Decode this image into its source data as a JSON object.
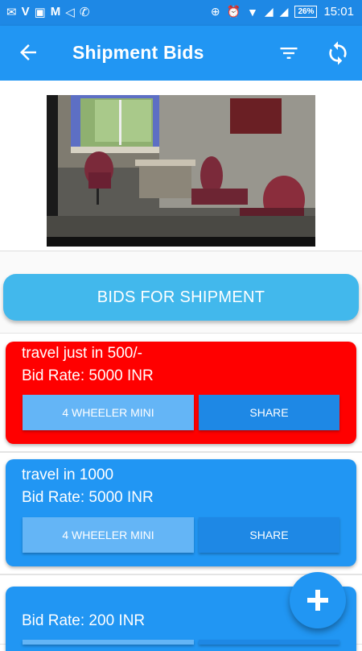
{
  "status_bar": {
    "left_icons": [
      "✉",
      "V",
      "▣",
      "M",
      "◁",
      "✆"
    ],
    "battery": "26%",
    "time": "15:01"
  },
  "app_bar": {
    "title": "Shipment Bids",
    "back_icon": "arrow-left-icon",
    "filter_icon": "filter-icon",
    "refresh_icon": "sync-icon"
  },
  "main": {
    "bids_button_label": "BIDS FOR SHIPMENT",
    "bids": [
      {
        "title": "travel just in 500/-",
        "rate": "Bid Rate: 5000 INR",
        "vehicle": "4 WHEELER MINI",
        "share": "SHARE",
        "color": "#ff0000"
      },
      {
        "title": "travel in 1000",
        "rate": "Bid Rate: 5000 INR",
        "vehicle": "4 WHEELER MINI",
        "share": "SHARE",
        "color": "#2196f3"
      },
      {
        "title": "",
        "rate": "Bid Rate: 200 INR",
        "vehicle": "",
        "share": "",
        "color": "#2196f3"
      }
    ]
  },
  "fab": {
    "icon": "plus-icon"
  },
  "colors": {
    "primary": "#2196f3",
    "status_bar": "#1e88e5",
    "accent_button": "#42b8ec",
    "alert": "#ff0000"
  }
}
